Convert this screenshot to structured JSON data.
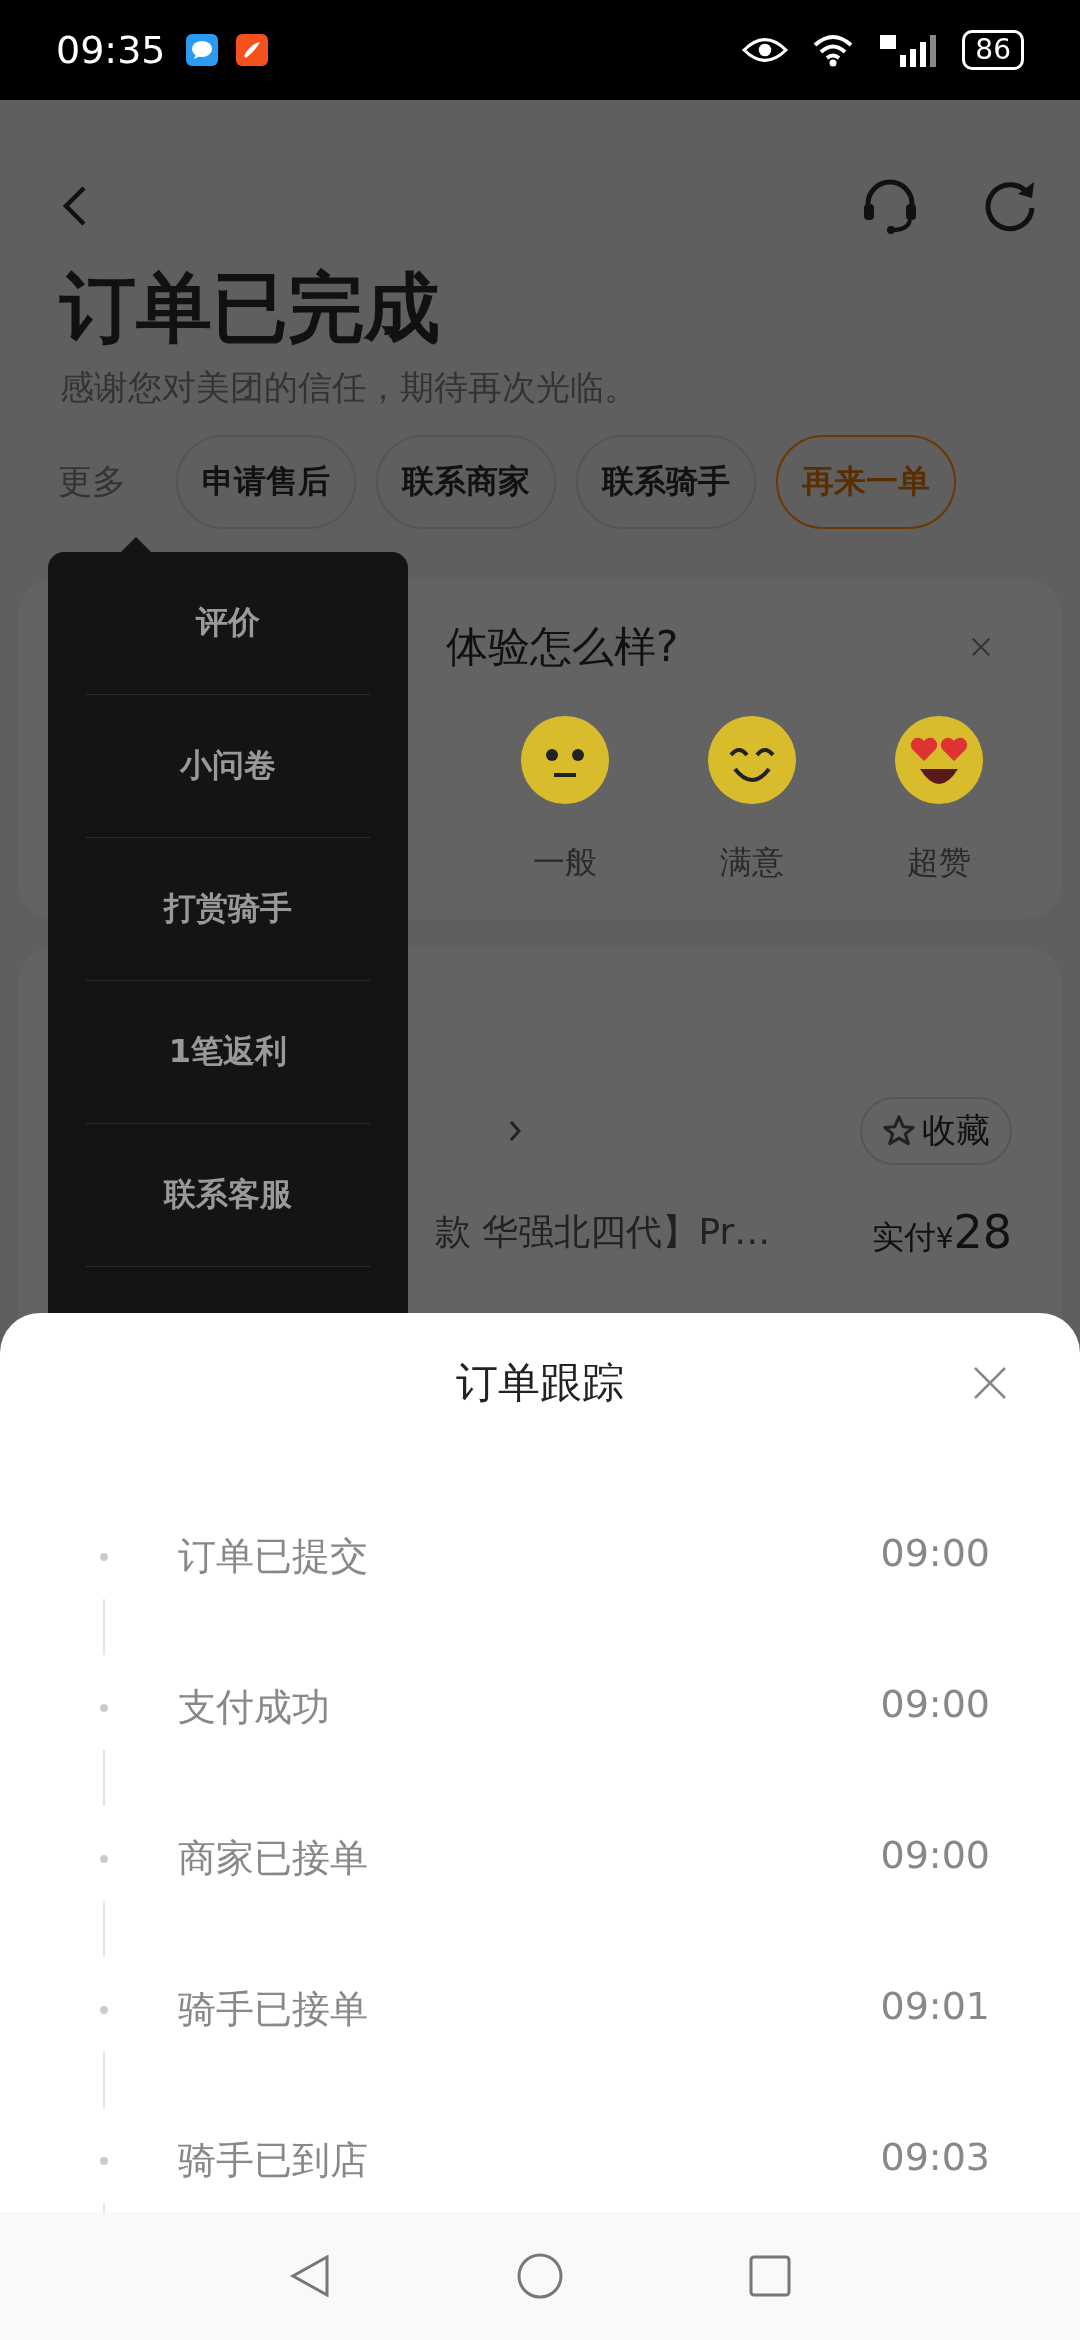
{
  "status_bar": {
    "time": "09:35",
    "battery": "86"
  },
  "header": {
    "title": "订单已完成",
    "subtitle": "感谢您对美团的信任，期待再次光临。"
  },
  "actions": {
    "more": "更多",
    "buttons": [
      {
        "label": "申请售后",
        "kind": "plain"
      },
      {
        "label": "联系商家",
        "kind": "plain"
      },
      {
        "label": "联系骑手",
        "kind": "plain"
      },
      {
        "label": "再来一单",
        "kind": "primary"
      }
    ]
  },
  "more_menu": {
    "items": [
      "评价",
      "小问卷",
      "打赏骑手",
      "1笔返利",
      "联系客服"
    ]
  },
  "rating_card": {
    "question": "体验怎么样?",
    "options": [
      {
        "label": "一般",
        "kind": "neutral"
      },
      {
        "label": "满意",
        "kind": "smile"
      },
      {
        "label": "超赞",
        "kind": "love"
      }
    ]
  },
  "product_card": {
    "favorite": "收藏",
    "item": {
      "title": "款 华强北四代】Pr…",
      "price_label": "实付",
      "currency": "¥",
      "price": "28"
    }
  },
  "tracking_sheet": {
    "title": "订单跟踪",
    "steps": [
      {
        "label": "订单已提交",
        "time": "09:00"
      },
      {
        "label": "支付成功",
        "time": "09:00"
      },
      {
        "label": "商家已接单",
        "time": "09:00"
      },
      {
        "label": "骑手已接单",
        "time": "09:01"
      },
      {
        "label": "骑手已到店",
        "time": "09:03"
      }
    ]
  }
}
